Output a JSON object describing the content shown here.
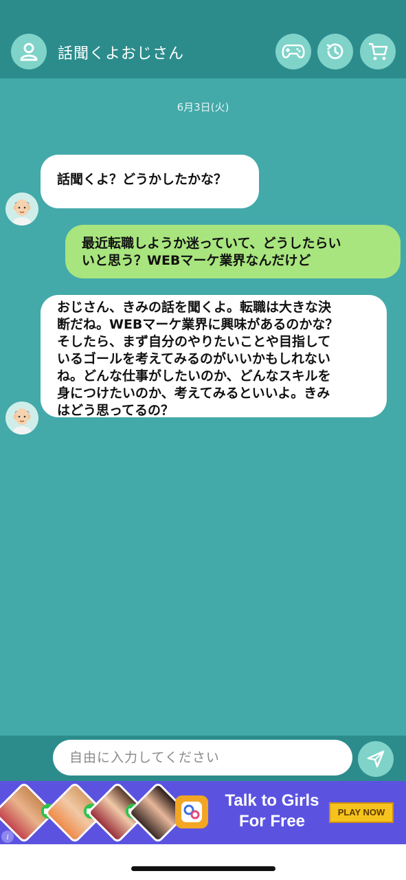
{
  "header": {
    "title": "話聞くよおじさん",
    "icons": [
      "user-icon",
      "gamepad-icon",
      "history-icon",
      "cart-icon"
    ]
  },
  "chat": {
    "date": "6月3日(火)",
    "messages": [
      {
        "sender": "ojisan",
        "text": "話聞くよ？どうかしたかな？"
      },
      {
        "sender": "user",
        "lines": [
          "最近転職しようか迷っていて、どうしたらい",
          "いと思う？WEBマーケ業界なんだけど"
        ]
      },
      {
        "sender": "ojisan",
        "lines": [
          "おじさん、きみの話を聞くよ。転職は大きな決",
          "断だね。WEBマーケ業界に興味があるのかな？",
          "そしたら、まず自分のやりたいことや目指して",
          "いるゴールを考えてみるのがいいかもしれない",
          "ね。どんな仕事がしたいのか、どんなスキルを",
          "身につけたいのか、考えてみるといいよ。きみ",
          "はどう思ってるの？"
        ]
      }
    ]
  },
  "input": {
    "placeholder": "自由に入力してください"
  },
  "ad": {
    "text_line1": "Talk to Girls",
    "text_line2": "For Free",
    "button": "PLAY NOW",
    "info": "i"
  },
  "colors": {
    "header_bg": "#2c8c8c",
    "chat_bg": "#43a9a9",
    "user_bubble": "#a8e57e",
    "icon_circle": "#7fd3c9",
    "ad_bg": "#5b53e0"
  }
}
